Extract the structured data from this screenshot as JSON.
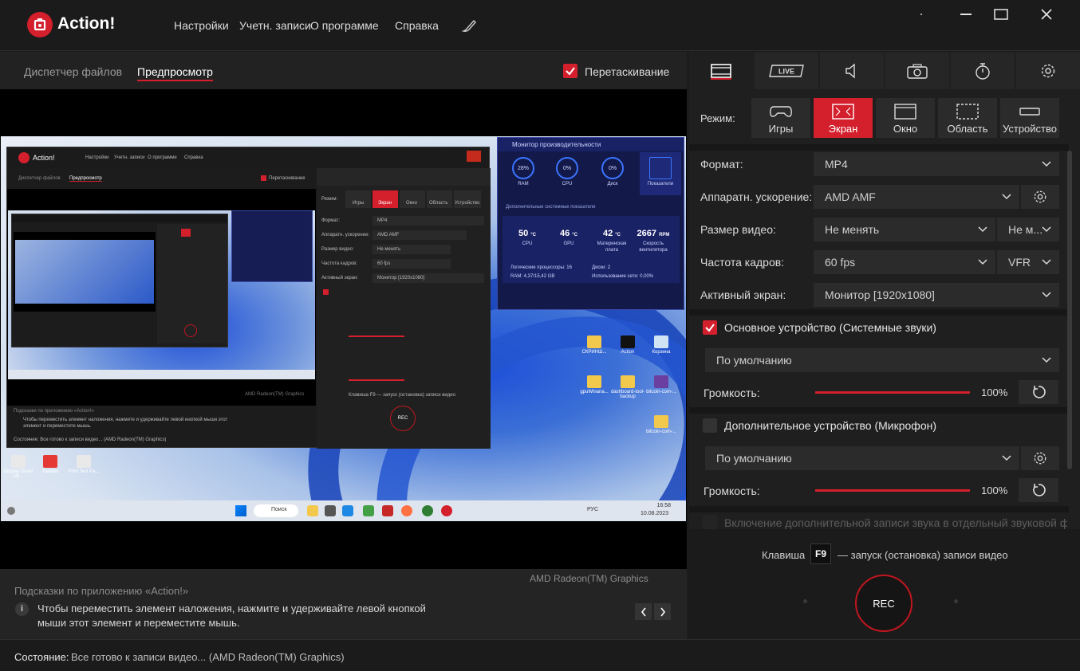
{
  "app": {
    "title": "Action!"
  },
  "menu": [
    "Настройки",
    "Учетн. записи",
    "О программе",
    "Справка"
  ],
  "left_tabs": {
    "file_manager": "Диспетчер файлов",
    "preview": "Предпросмотр"
  },
  "drag": {
    "label": "Перетаскивание",
    "checked": true
  },
  "preview": {
    "inner_window_title": "Action!",
    "inner_menu": [
      "Настройки",
      "Учетн. записи",
      "О программе",
      "Справка"
    ],
    "inner_tabs": [
      "Диспетчер файлов",
      "Предпросмотр"
    ],
    "inner_drag": "Перетаскивание",
    "inner_hint_title": "Подсказки по приложению «Action!»",
    "inner_hint_text": "Чтобы переместить элемент наложения, нажмите и удерживайте левой кнопкой мыши этот элемент и переместите мышь.",
    "inner_gpu": "AMD Radeon(TM) Graphics",
    "inner_status": "Состояние: Все готово к записи видео... (AMD Radeon(TM) Graphics)",
    "inner_modes": [
      "Игры",
      "Экран",
      "Окно",
      "Область",
      "Устройство"
    ],
    "inner_rows": [
      {
        "label": "Формат:",
        "value": "MP4"
      },
      {
        "label": "Аппаратн. ускорение:",
        "value": "AMD AMF"
      },
      {
        "label": "Размер видео:",
        "value": "Не менять"
      },
      {
        "label": "Частота кадров:",
        "value": "60 fps"
      },
      {
        "label": "Активный экран:",
        "value": "Монитор [1920x1080]"
      }
    ],
    "inner_hotkey": "Клавиша F9 — запуск (остановка) записи видео",
    "inner_rec": "REC",
    "perf": {
      "title": "Монитор производительности",
      "metrics": [
        {
          "label": "RAM",
          "value": "28%"
        },
        {
          "label": "CPU",
          "value": "0%"
        },
        {
          "label": "Диск",
          "value": "0%"
        },
        {
          "label": "Показатели",
          "value": ""
        }
      ],
      "subtitle": "Дополнительные системные показатели",
      "values": [
        {
          "value": "50",
          "unit": "°C",
          "label": "CPU"
        },
        {
          "value": "46",
          "unit": "°C",
          "label": "GPU"
        },
        {
          "value": "42",
          "unit": "°C",
          "label": "Материнская плата"
        },
        {
          "value": "2667",
          "unit": "RPM",
          "label": "Скорость вентилятора"
        }
      ],
      "logical_processors": "Логические процессоры: 16",
      "ram": "RAM: 4,37/15,42 GB",
      "disks": "Диски: 2",
      "network": "Использование сети: 0,00%"
    },
    "desktop_icons": [
      "СКРИНШ...",
      "Action",
      "Корзина",
      "gpuWinana...",
      "dashboard-tool-backup",
      "bitcoin-com-...",
      "Display Driver Un...",
      "Yandex",
      "Print Test Pa...",
      "bitcoin-com-..."
    ],
    "taskbar": {
      "search": "Поиск",
      "lang": "РУС",
      "time": "16:58",
      "date": "10.08.2023"
    }
  },
  "hints": {
    "gpu": "AMD Radeon(TM) Graphics",
    "title": "Подсказки по приложению «Action!»",
    "text": "Чтобы переместить элемент наложения, нажмите и удерживайте левой кнопкой мыши этот элемент и переместите мышь."
  },
  "status": {
    "label": "Состояние:",
    "text": "Все готово к записи видео... (AMD Radeon(TM) Graphics)"
  },
  "right_tabs": [
    {
      "name": "video-tab",
      "icon": "film-icon",
      "active": true
    },
    {
      "name": "live-tab",
      "icon": "live-icon",
      "label": "LIVE"
    },
    {
      "name": "audio-tab",
      "icon": "speaker-icon"
    },
    {
      "name": "screenshot-tab",
      "icon": "camera-icon"
    },
    {
      "name": "timer-tab",
      "icon": "stopwatch-icon"
    },
    {
      "name": "settings-tab",
      "icon": "gear-icon"
    }
  ],
  "mode": {
    "label": "Режим:",
    "options": [
      "Игры",
      "Экран",
      "Окно",
      "Область",
      "Устройство"
    ],
    "active": "Экран"
  },
  "settings": {
    "format_label": "Формат:",
    "format_value": "MP4",
    "hw_label": "Аппаратн. ускорение:",
    "hw_value": "AMD AMF",
    "size_label": "Размер видео:",
    "size_value": "Не менять",
    "size_value2": "Не м...",
    "fps_label": "Частота кадров:",
    "fps_value": "60 fps",
    "fps_mode": "VFR",
    "screen_label": "Активный экран:",
    "screen_value": "Монитор [1920x1080]"
  },
  "audio": {
    "main_device_label": "Основное устройство (Системные звуки)",
    "main_device_checked": true,
    "main_device_value": "По умолчанию",
    "main_volume_label": "Громкость:",
    "main_volume": 100,
    "main_volume_text": "100%",
    "extra_device_label": "Дополнительное устройство (Микрофон)",
    "extra_device_checked": false,
    "extra_device_value": "По умолчанию",
    "extra_volume_label": "Громкость:",
    "extra_volume": 100,
    "extra_volume_text": "100%",
    "separate_file_label": "Включение дополнительной записи звука в отдельный звуковой файл"
  },
  "record": {
    "hotkey_prefix": "Клавиша",
    "hotkey": "F9",
    "hotkey_suffix": "— запуск (остановка) записи видео",
    "rec_label": "REC"
  },
  "colors": {
    "accent": "#d41f2c",
    "bg": "#1e1e1e",
    "panel": "#2b2b2b"
  }
}
